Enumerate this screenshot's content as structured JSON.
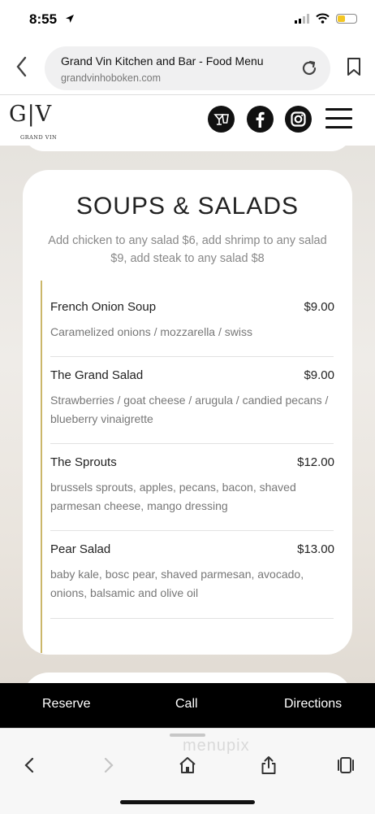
{
  "status": {
    "time": "8:55"
  },
  "browser": {
    "page_title": "Grand Vin Kitchen and Bar - Food Menu",
    "host": "grandvinhoboken.com"
  },
  "site": {
    "logo_text": "G|V",
    "logo_sub": "GRAND VIN",
    "social": [
      "cocktail-icon",
      "facebook-icon",
      "instagram-icon"
    ]
  },
  "menu": {
    "title": "SOUPS & SALADS",
    "note": "Add chicken to any salad $6, add shrimp to any salad $9, add steak to any salad $8",
    "items": [
      {
        "name": "French Onion Soup",
        "price": "$9.00",
        "desc": "Caramelized onions / mozzarella / swiss"
      },
      {
        "name": "The Grand Salad",
        "price": "$9.00",
        "desc": "Strawberries / goat cheese / arugula / candied pecans / blueberry vinaigrette"
      },
      {
        "name": "The Sprouts",
        "price": "$12.00",
        "desc": "brussels sprouts, apples, pecans, bacon, shaved parmesan cheese, mango dressing"
      },
      {
        "name": "Pear Salad",
        "price": "$13.00",
        "desc": "baby kale, bosc pear, shaved parmesan, avocado, onions, balsamic and olive oil"
      }
    ]
  },
  "actions": {
    "reserve": "Reserve",
    "call": "Call",
    "directions": "Directions"
  },
  "watermark": "menupix",
  "colors": {
    "accent_gold": "#cbb76a",
    "battery": "#f3c623"
  }
}
